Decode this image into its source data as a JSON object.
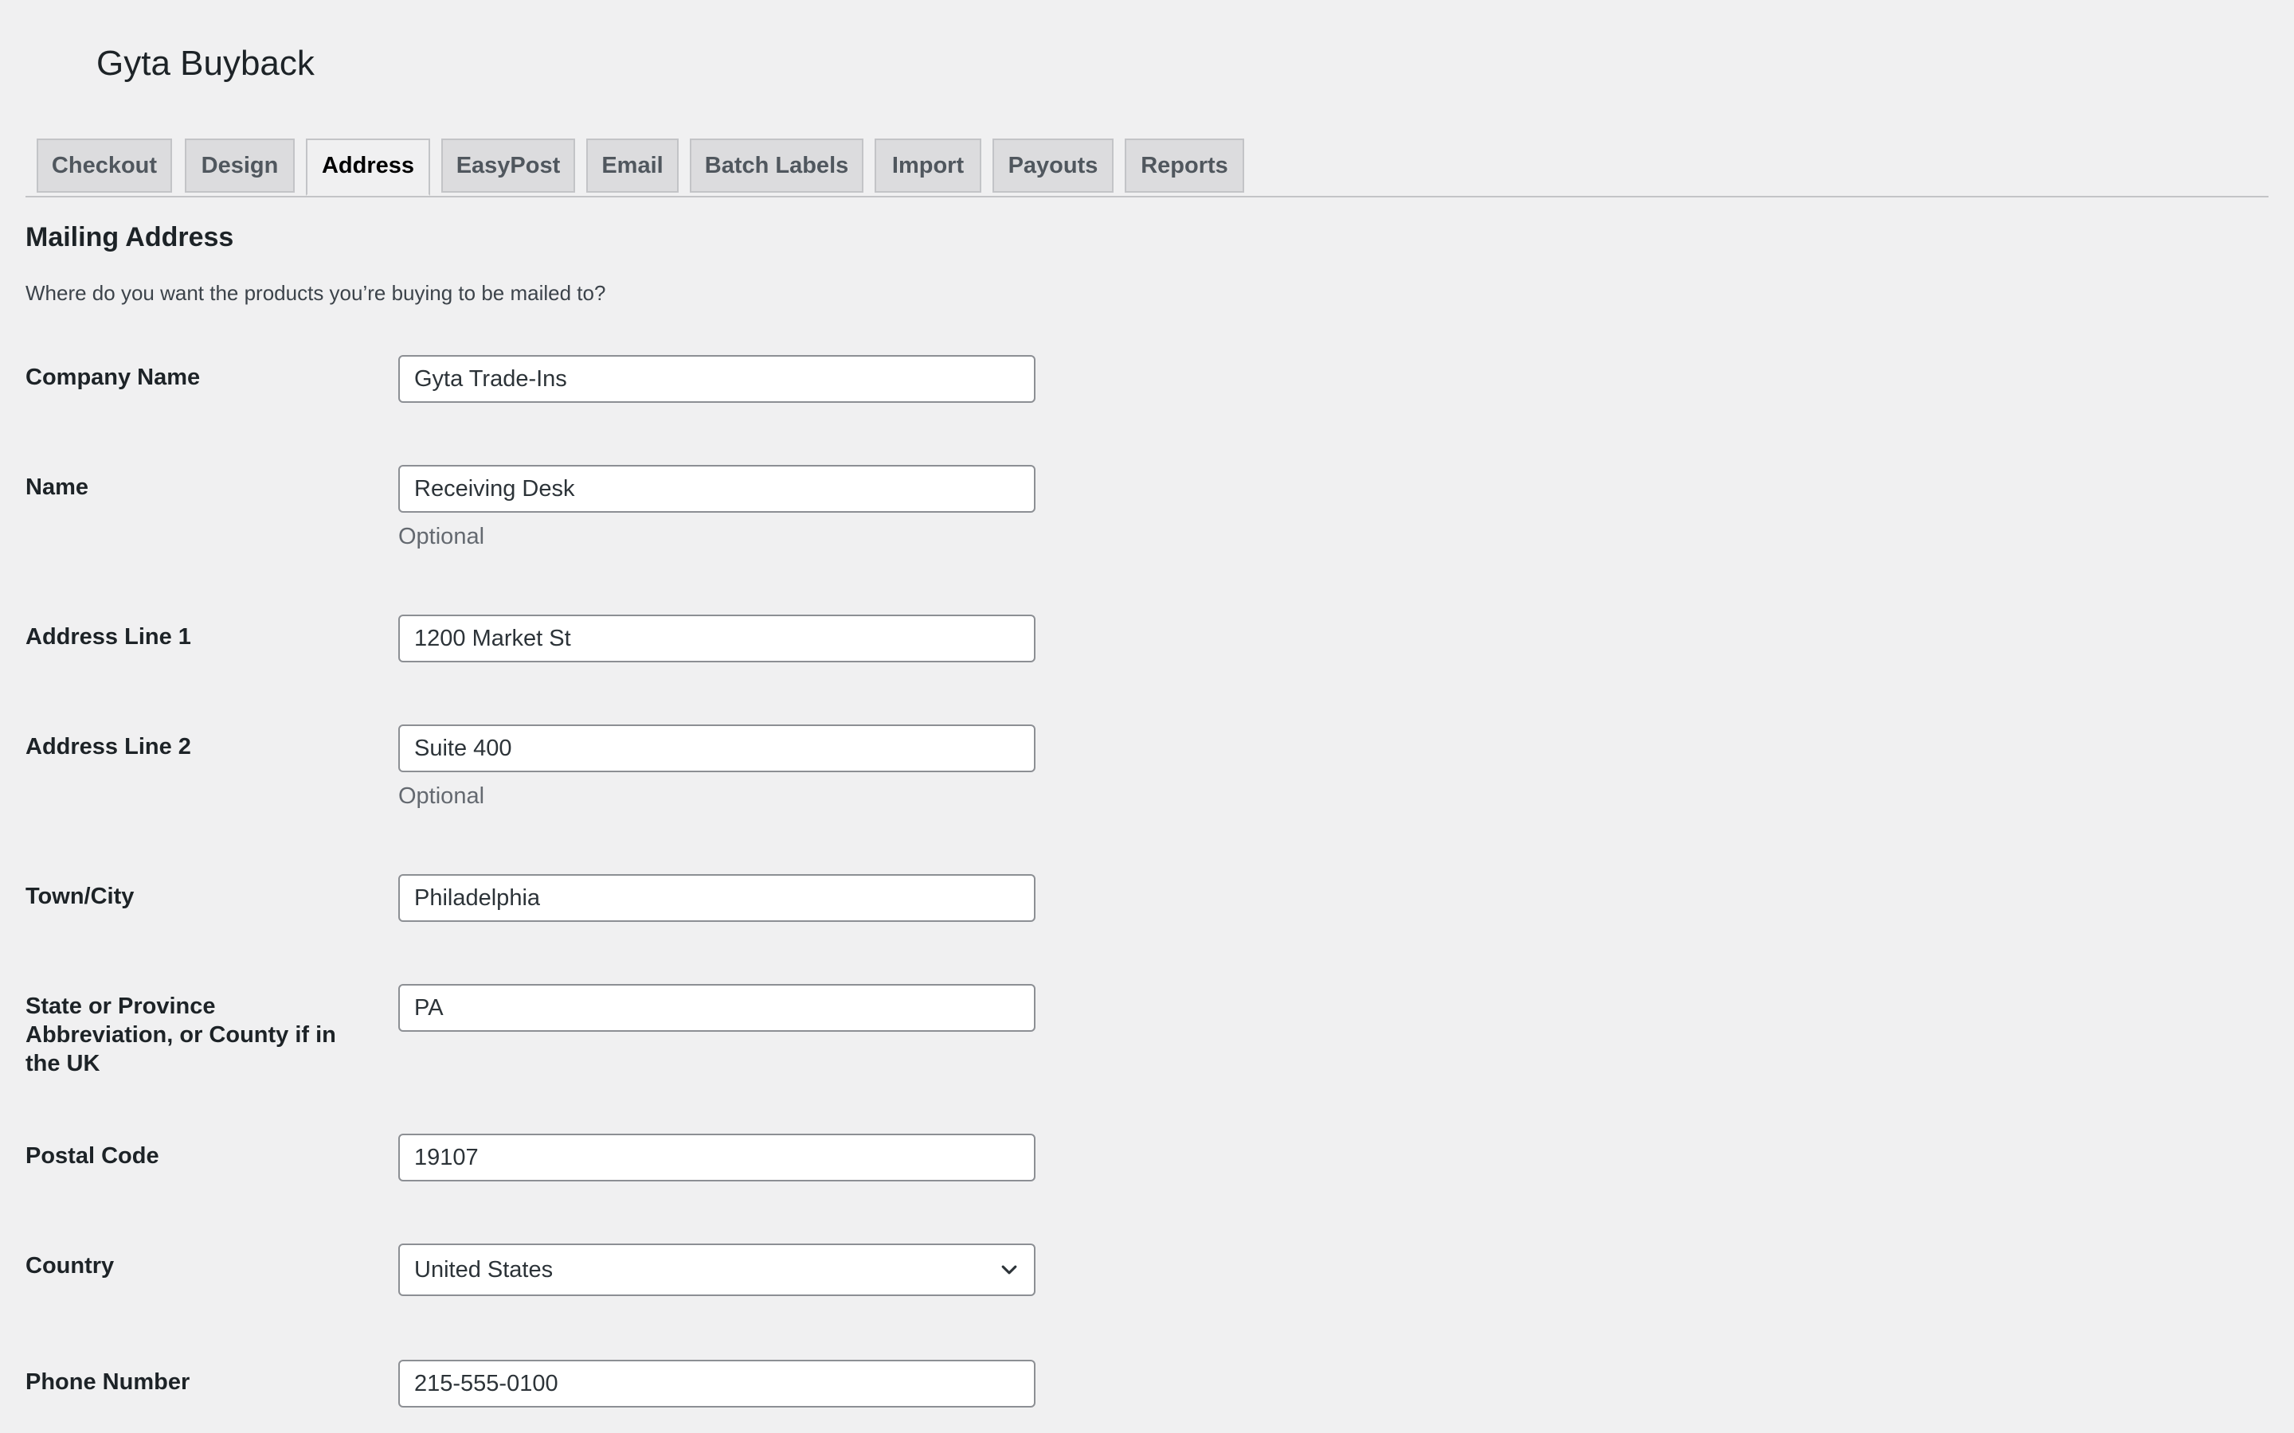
{
  "app": {
    "title": "Gyta Buyback"
  },
  "tabs": [
    {
      "label": "Checkout",
      "active": false
    },
    {
      "label": "Design",
      "active": false
    },
    {
      "label": "Address",
      "active": true
    },
    {
      "label": "EasyPost",
      "active": false
    },
    {
      "label": "Email",
      "active": false
    },
    {
      "label": "Batch Labels",
      "active": false
    },
    {
      "label": "Import",
      "active": false
    },
    {
      "label": "Payouts",
      "active": false
    },
    {
      "label": "Reports",
      "active": false
    }
  ],
  "section": {
    "title": "Mailing Address",
    "description": "Where do you want the products you’re buying to be mailed to?"
  },
  "form": {
    "company_name": {
      "label": "Company Name",
      "value": "Gyta Trade-Ins"
    },
    "name": {
      "label": "Name",
      "value": "Receiving Desk",
      "help": "Optional"
    },
    "address_line_1": {
      "label": "Address Line 1",
      "value": "1200 Market St"
    },
    "address_line_2": {
      "label": "Address Line 2",
      "value": "Suite 400",
      "help": "Optional"
    },
    "town_city": {
      "label": "Town/City",
      "value": "Philadelphia"
    },
    "state": {
      "label": "State or Province Abbreviation, or County if in the UK",
      "value": "PA"
    },
    "postal_code": {
      "label": "Postal Code",
      "value": "19107"
    },
    "country": {
      "label": "Country",
      "value": "United States",
      "icon": "chevron-down-icon"
    },
    "phone_number": {
      "label": "Phone Number",
      "value": "215-555-0100"
    }
  },
  "colors": {
    "background": "#f0f0f1",
    "tab_inactive_bg": "#dcdcde",
    "border": "#c3c4c7",
    "input_border": "#8c8f94",
    "text": "#1d2327",
    "muted_text": "#646970"
  }
}
